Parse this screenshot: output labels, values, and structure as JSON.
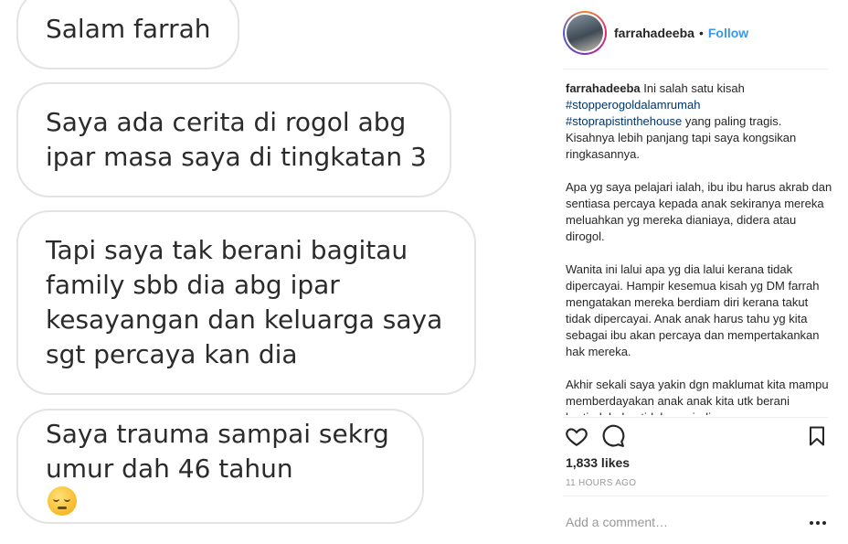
{
  "photo": {
    "messages": [
      {
        "lines": [
          "Salam farrah"
        ]
      },
      {
        "lines": [
          "Saya ada cerita di rogol abg",
          "ipar masa saya di tingkatan 3"
        ]
      },
      {
        "lines": [
          "Tapi saya tak berani bagitau",
          "family sbb dia abg ipar",
          "kesayangan dan keluarga saya",
          "sgt percaya kan dia"
        ]
      },
      {
        "lines": [
          "Saya trauma sampai sekrg",
          "umur dah 46 tahun"
        ],
        "emoji": "pensive-face-emoji"
      }
    ]
  },
  "post": {
    "username": "farrahadeeba",
    "separator": "•",
    "follow_label": "Follow",
    "caption": {
      "username": "farrahadeeba",
      "intro": "Ini salah satu kisah",
      "hashtag1": "#stopperogoldalamrumah",
      "hashtag2": "#stoprapistinthehouse",
      "intro_rest": "yang paling tragis. Kisahnya lebih panjang tapi saya kongsikan ringkasannya.",
      "para2": "Apa yg saya pelajari ialah, ibu ibu harus akrab dan sentiasa percaya kepada anak sekiranya mereka meluahkan yg mereka dianiaya, didera atau dirogol.",
      "para3": "Wanita ini lalui apa yg dia lalui kerana tidak dipercayai. Hampir kesemua kisah yg DM farrah mengatakan mereka berdiam diri kerana takut tidak dipercayai. Anak anak harus tahu yg kita sebagai ibu akan percaya dan mempertakankan hak mereka.",
      "para4": "Akhir sekali saya yakin dgn maklumat kita mampu memberdayakan anak anak kita utk berani bertindak dan tidak menjadi mangsa."
    },
    "likes": "1,833 likes",
    "timestamp": "11 HOURS AGO",
    "comment_placeholder": "Add a comment…",
    "icons": {
      "like": "heart-icon",
      "comment": "comment-icon",
      "save": "bookmark-icon",
      "more": "more-options-icon"
    }
  }
}
